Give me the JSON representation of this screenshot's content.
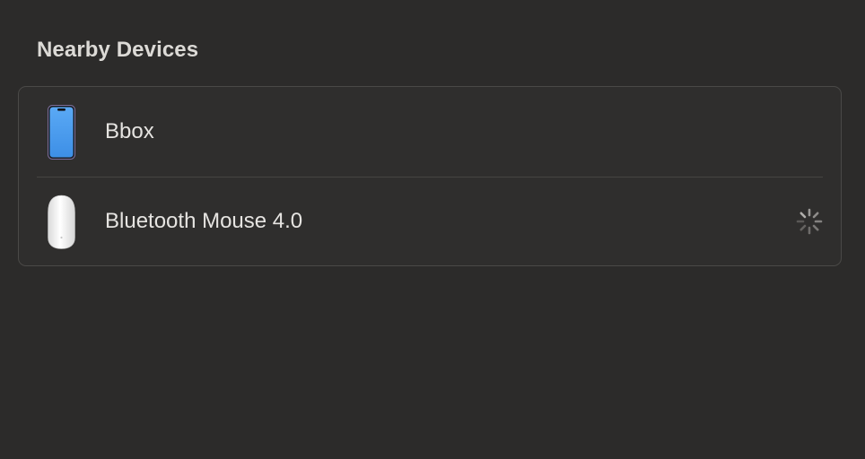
{
  "section": {
    "title": "Nearby Devices"
  },
  "devices": [
    {
      "name": "Bbox",
      "icon": "iphone-icon",
      "status": ""
    },
    {
      "name": "Bluetooth Mouse 4.0",
      "icon": "magic-mouse-icon",
      "status": "connecting"
    }
  ],
  "colors": {
    "background": "#2c2b2a",
    "panel": "#2f2e2d",
    "border": "#4a4947",
    "phone_screen": "#4a9df0"
  }
}
